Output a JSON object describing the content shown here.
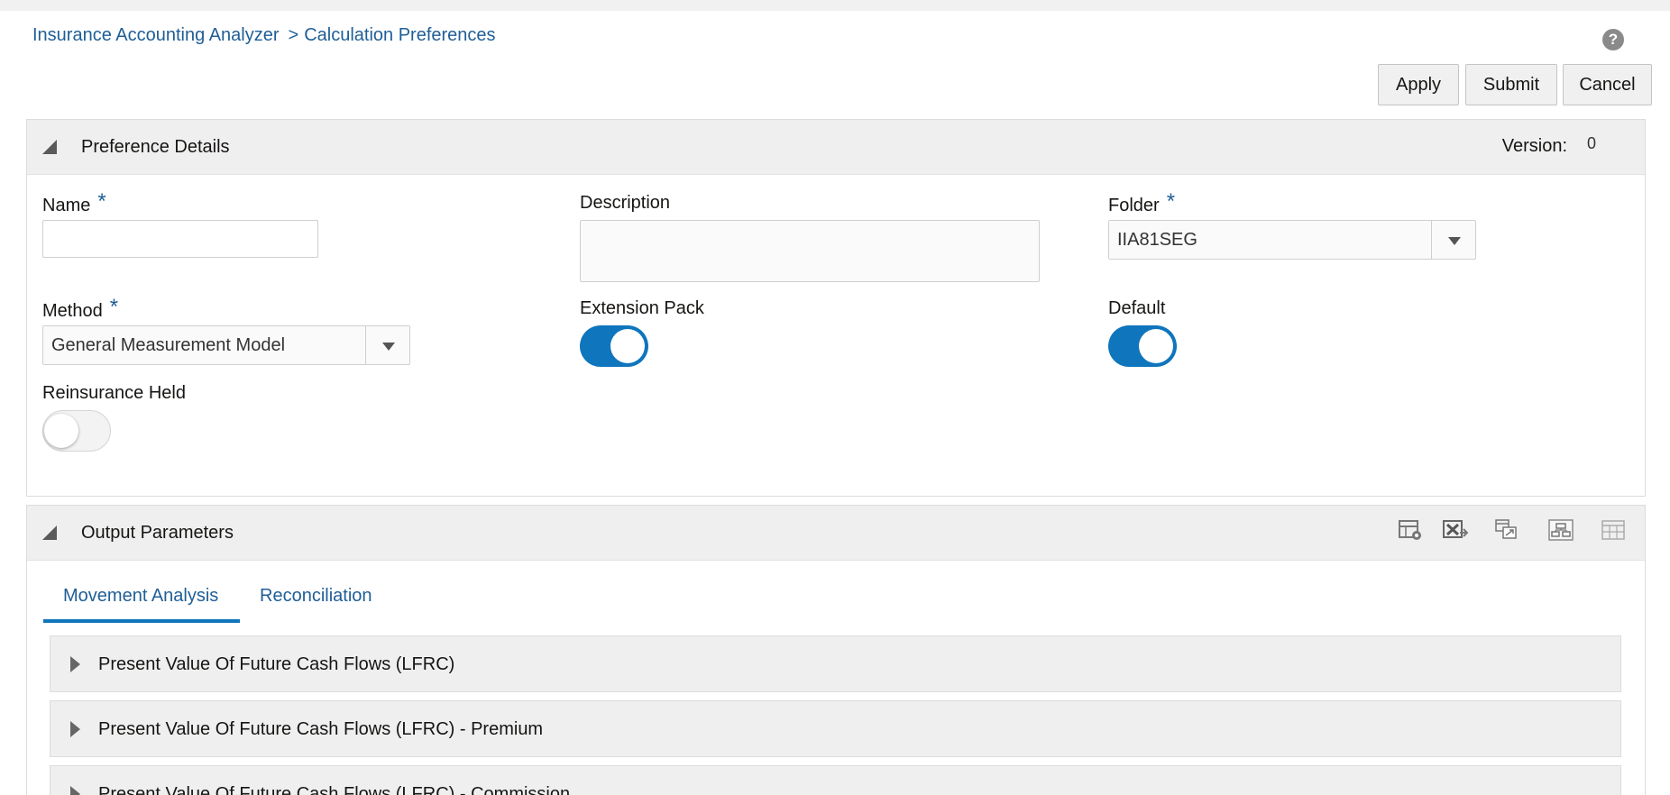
{
  "breadcrumb": {
    "root": "Insurance Accounting Analyzer",
    "separator": ">",
    "current": "Calculation Preferences"
  },
  "help": {
    "icon": "help-icon",
    "glyph": "?"
  },
  "toolbar": {
    "apply": "Apply",
    "submit": "Submit",
    "cancel": "Cancel"
  },
  "preference_details": {
    "title": "Preference Details",
    "version_label": "Version:",
    "version_value": "0",
    "name": {
      "label": "Name",
      "required_mark": "*",
      "value": ""
    },
    "description": {
      "label": "Description",
      "value": ""
    },
    "folder": {
      "label": "Folder",
      "required_mark": "*",
      "value": "IIA81SEG"
    },
    "method": {
      "label": "Method",
      "required_mark": "*",
      "value": "General Measurement Model"
    },
    "extension_pack": {
      "label": "Extension Pack",
      "on": true
    },
    "default": {
      "label": "Default",
      "on": true
    },
    "reinsurance_held": {
      "label": "Reinsurance Held",
      "on": false
    }
  },
  "output_parameters": {
    "title": "Output Parameters",
    "icons": [
      "settings-grid-icon",
      "export-excel-icon",
      "detach-table-icon",
      "expand-table-icon",
      "delete-table-icon"
    ],
    "tabs": [
      {
        "label": "Movement Analysis",
        "active": true
      },
      {
        "label": "Reconciliation",
        "active": false
      }
    ],
    "sections": [
      "Present Value Of Future Cash Flows (LFRC)",
      "Present Value Of Future Cash Flows (LFRC) - Premium",
      "Present Value Of Future Cash Flows (LFRC) - Commission"
    ]
  },
  "colors": {
    "accent": "#0f75bc",
    "link": "#1f5e96",
    "header_bg": "#efefef"
  }
}
